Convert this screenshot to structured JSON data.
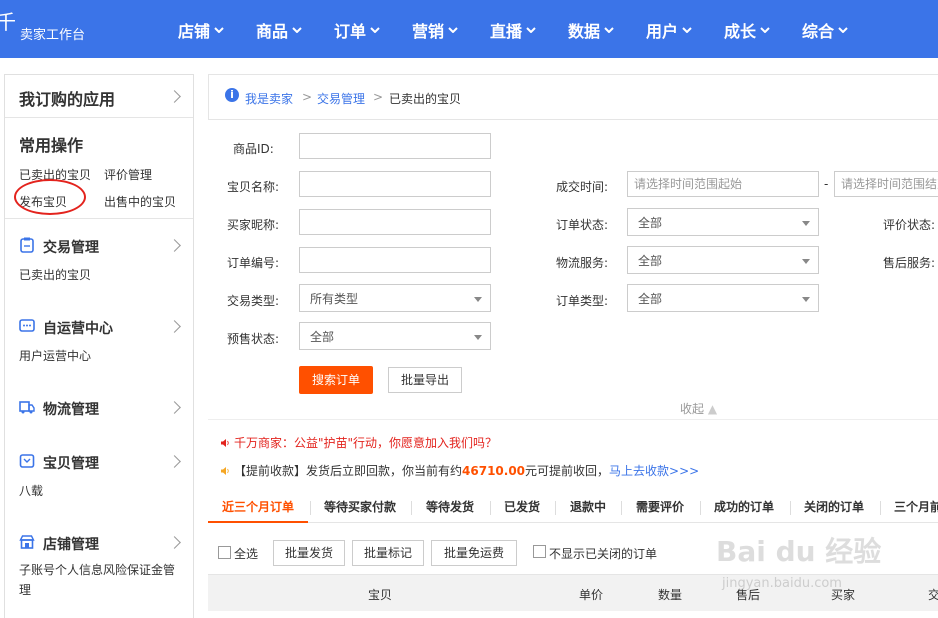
{
  "header": {
    "logo_char": "千",
    "brand": "卖家工作台",
    "nav": [
      "店铺",
      "商品",
      "订单",
      "营销",
      "直播",
      "数据",
      "用户",
      "成长",
      "综合"
    ]
  },
  "sidebar": {
    "apps_title": "我订购的应用",
    "common_title": "常用操作",
    "common_links": [
      "已卖出的宝贝",
      "评价管理",
      "发布宝贝",
      "出售中的宝贝"
    ],
    "modules": [
      {
        "title": "交易管理",
        "sub": "已卖出的宝贝",
        "icon": "clipboard-icon"
      },
      {
        "title": "自运营中心",
        "sub": "用户运营中心",
        "icon": "chat-icon"
      },
      {
        "title": "物流管理",
        "sub": "",
        "icon": "truck-icon"
      },
      {
        "title": "宝贝管理",
        "sub": "八载",
        "icon": "box-icon"
      },
      {
        "title": "店铺管理",
        "sub": "子账号个人信息风险保证金管理",
        "icon": "store-icon"
      }
    ]
  },
  "breadcrumb": [
    "我是卖家",
    "交易管理",
    "已卖出的宝贝"
  ],
  "form": {
    "product_id_label": "商品ID:",
    "item_name_label": "宝贝名称:",
    "buyer_nick_label": "买家昵称:",
    "order_no_label": "订单编号:",
    "trade_type_label": "交易类型:",
    "trade_type_value": "所有类型",
    "presale_label": "预售状态:",
    "presale_value": "全部",
    "deal_time_label": "成交时间:",
    "deal_time_start_placeholder": "请选择时间范围起始",
    "deal_time_end_placeholder": "请选择时间范围结束",
    "order_status_label": "订单状态:",
    "order_status_value": "全部",
    "logistics_label": "物流服务:",
    "logistics_value": "全部",
    "order_type_label": "订单类型:",
    "order_type_value": "全部",
    "review_status_label": "评价状态:",
    "after_sale_label": "售后服务:",
    "search_button": "搜索订单",
    "export_button": "批量导出",
    "collapse": "收起"
  },
  "notices": {
    "charity": "千万商家：公益\"护苗\"行动，你愿意加入我们吗？",
    "prepay_prefix": "【提前收款】发货后立即回款，你当前有约",
    "prepay_amount": "46710.00",
    "prepay_suffix": "元可提前收回，",
    "prepay_link": "马上去收款>>>"
  },
  "tabs": [
    "近三个月订单",
    "等待买家付款",
    "等待发货",
    "已发货",
    "退款中",
    "需要评价",
    "成功的订单",
    "关闭的订单",
    "三个月前"
  ],
  "bulk": {
    "select_all": "全选",
    "batch_ship": "批量发货",
    "batch_mark": "批量标记",
    "batch_free_ship": "批量免运费",
    "hide_closed": "不显示已关闭的订单"
  },
  "table_headers": [
    "宝贝",
    "单价",
    "数量",
    "售后",
    "买家",
    "交"
  ],
  "watermark": {
    "main": "Bai du 经验",
    "sub": "jingyan.baidu.com"
  },
  "colors": {
    "header": "#3b74e8",
    "accent": "#ff5000",
    "highlight_circle": "#e3231d"
  }
}
